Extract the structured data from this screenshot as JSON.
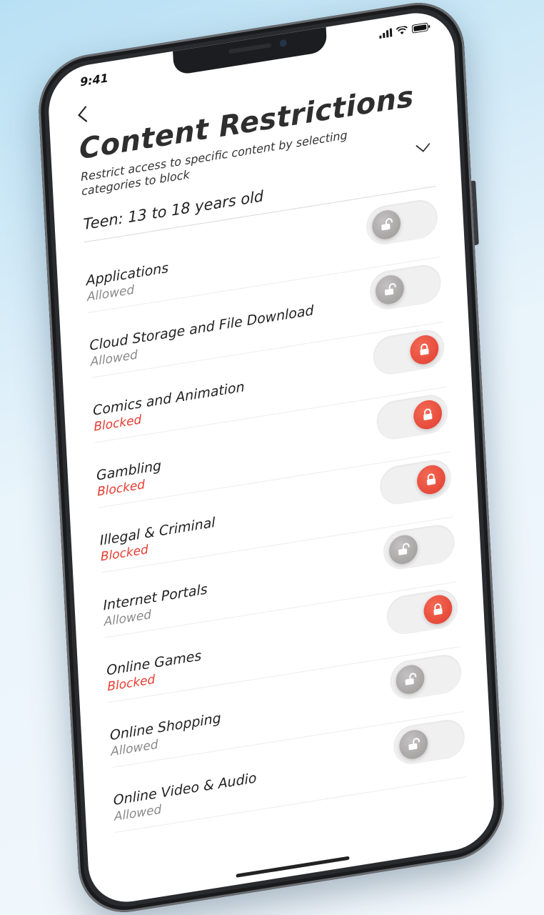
{
  "status_bar": {
    "time": "9:41"
  },
  "header": {
    "back_label": "<",
    "title": "Content Restrictions",
    "subtitle": "Restrict access to specific content by selecting categories to block"
  },
  "age_filter": {
    "selected": "Teen: 13 to 18 years old"
  },
  "categories": [
    {
      "name": "Applications",
      "status": "Allowed",
      "blocked": false
    },
    {
      "name": "Cloud Storage and File Download",
      "status": "Allowed",
      "blocked": false
    },
    {
      "name": "Comics and Animation",
      "status": "Blocked",
      "blocked": true
    },
    {
      "name": "Gambling",
      "status": "Blocked",
      "blocked": true
    },
    {
      "name": "Illegal & Criminal",
      "status": "Blocked",
      "blocked": true
    },
    {
      "name": "Internet Portals",
      "status": "Allowed",
      "blocked": false
    },
    {
      "name": "Online Games",
      "status": "Blocked",
      "blocked": true
    },
    {
      "name": "Online Shopping",
      "status": "Allowed",
      "blocked": false
    },
    {
      "name": "Online Video & Audio",
      "status": "Allowed",
      "blocked": false
    }
  ],
  "colors": {
    "blocked": "#e53b30",
    "allowed": "#8a8a8a",
    "knob_blocked": "#e03c2f",
    "knob_allowed": "#9a9797"
  },
  "icons": {
    "locked": "padlock-closed-icon",
    "unlocked": "padlock-open-icon",
    "back": "chevron-left-icon",
    "dropdown": "chevron-down-icon"
  }
}
